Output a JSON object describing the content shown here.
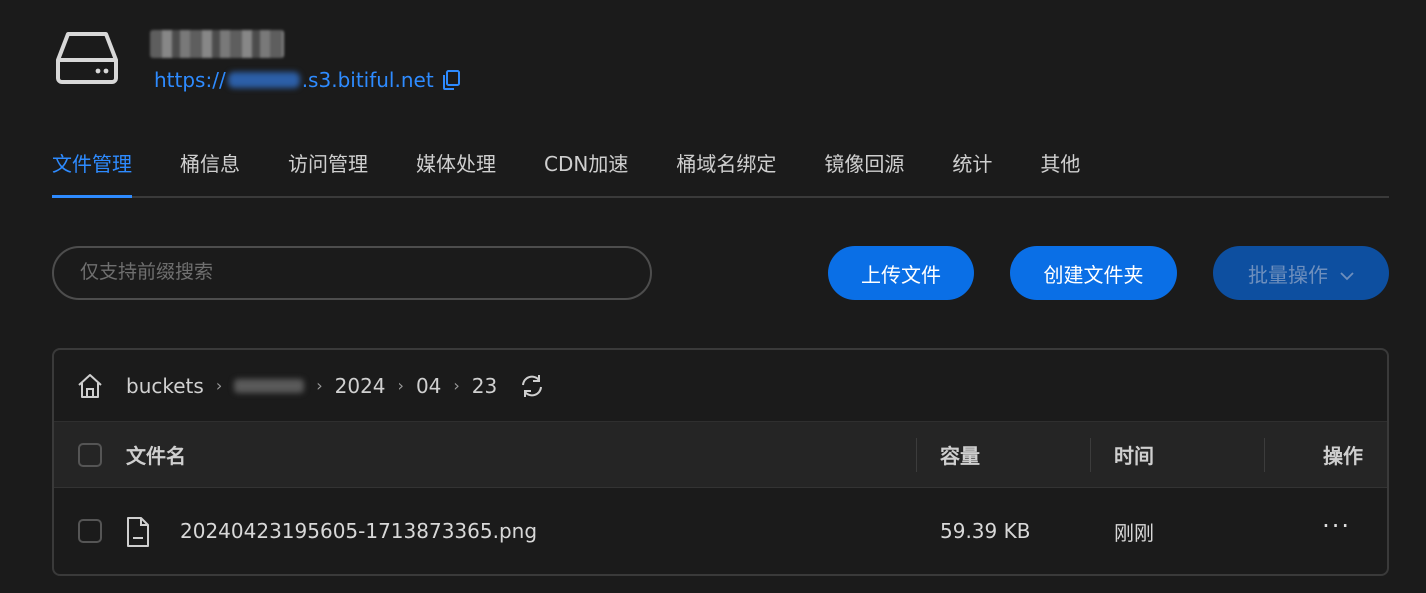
{
  "bucket": {
    "name": "█████",
    "url_prefix": "https://",
    "url_suffix": ".s3.bitiful.net"
  },
  "tabs": [
    {
      "label": "文件管理",
      "active": true
    },
    {
      "label": "桶信息"
    },
    {
      "label": "访问管理"
    },
    {
      "label": "媒体处理"
    },
    {
      "label": "CDN加速"
    },
    {
      "label": "桶域名绑定"
    },
    {
      "label": "镜像回源"
    },
    {
      "label": "统计"
    },
    {
      "label": "其他"
    }
  ],
  "search": {
    "placeholder": "仅支持前缀搜索"
  },
  "actions": {
    "upload_label": "上传文件",
    "create_folder_label": "创建文件夹",
    "batch_label": "批量操作"
  },
  "breadcrumb": {
    "root": "buckets",
    "path": [
      "2024",
      "04",
      "23"
    ]
  },
  "table": {
    "headers": {
      "name": "文件名",
      "size": "容量",
      "time": "时间",
      "ops": "操作"
    },
    "rows": [
      {
        "name": "20240423195605-1713873365.png",
        "size": "59.39 KB",
        "time": "刚刚",
        "more": "···"
      }
    ]
  },
  "colors": {
    "accent": "#2e8bff",
    "button": "#0a6fe6",
    "background": "#1b1b1b"
  },
  "icons": [
    "drive-icon",
    "copy-icon",
    "home-icon",
    "refresh-icon",
    "file-icon",
    "chevron-down-icon"
  ]
}
